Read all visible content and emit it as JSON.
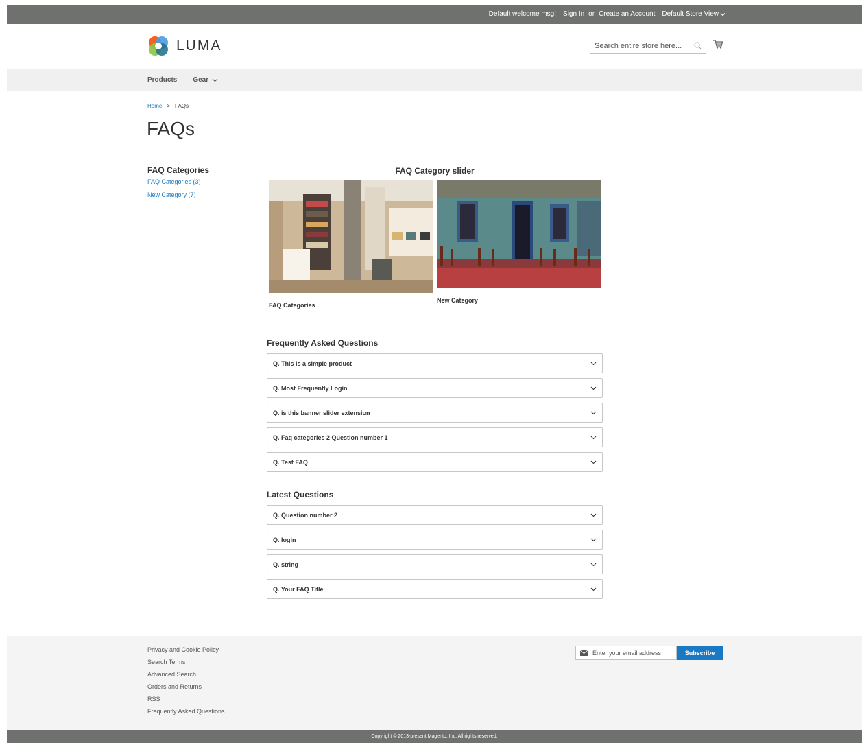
{
  "top_panel": {
    "welcome": "Default welcome msg!",
    "sign_in": "Sign In",
    "or": "or",
    "create_account": "Create an Account",
    "store_view": "Default Store View"
  },
  "header": {
    "logo_text": "LUMA",
    "search_placeholder": "Search entire store here..."
  },
  "nav": {
    "items": [
      {
        "label": "Products"
      },
      {
        "label": "Gear"
      }
    ]
  },
  "breadcrumb": {
    "home": "Home",
    "separator": ">",
    "current": "FAQs"
  },
  "page_title": "FAQs",
  "sidebar": {
    "title": "FAQ Categories",
    "links": [
      {
        "label": "FAQ Categories (3)"
      },
      {
        "label": "New Category (7)"
      }
    ]
  },
  "slider": {
    "title": "FAQ Category slider",
    "slides": [
      {
        "caption": "FAQ Categories"
      },
      {
        "caption": "New Category"
      }
    ]
  },
  "faq_section": {
    "title": "Frequently Asked Questions",
    "items": [
      {
        "question": "Q. This is a simple product"
      },
      {
        "question": "Q. Most Frequently Login"
      },
      {
        "question": "Q. is this banner slider extension"
      },
      {
        "question": "Q. Faq categories 2 Question number 1"
      },
      {
        "question": "Q. Test FAQ"
      }
    ]
  },
  "latest_section": {
    "title": "Latest Questions",
    "items": [
      {
        "question": "Q. Question number 2"
      },
      {
        "question": "Q. login"
      },
      {
        "question": "Q. string"
      },
      {
        "question": "Q. Your FAQ Title"
      }
    ]
  },
  "footer": {
    "links": [
      {
        "label": "Privacy and Cookie Policy"
      },
      {
        "label": "Search Terms"
      },
      {
        "label": "Advanced Search"
      },
      {
        "label": "Orders and Returns"
      },
      {
        "label": "RSS"
      },
      {
        "label": "Frequently Asked Questions"
      }
    ],
    "newsletter_placeholder": "Enter your email address",
    "subscribe_label": "Subscribe",
    "copyright": "Copyright © 2013-present Magento, Inc. All rights reserved."
  },
  "colors": {
    "link": "#1979c3",
    "top_panel": "#6e716e",
    "nav_bg": "#f0f0f0",
    "footer_bg": "#f4f4f4"
  }
}
